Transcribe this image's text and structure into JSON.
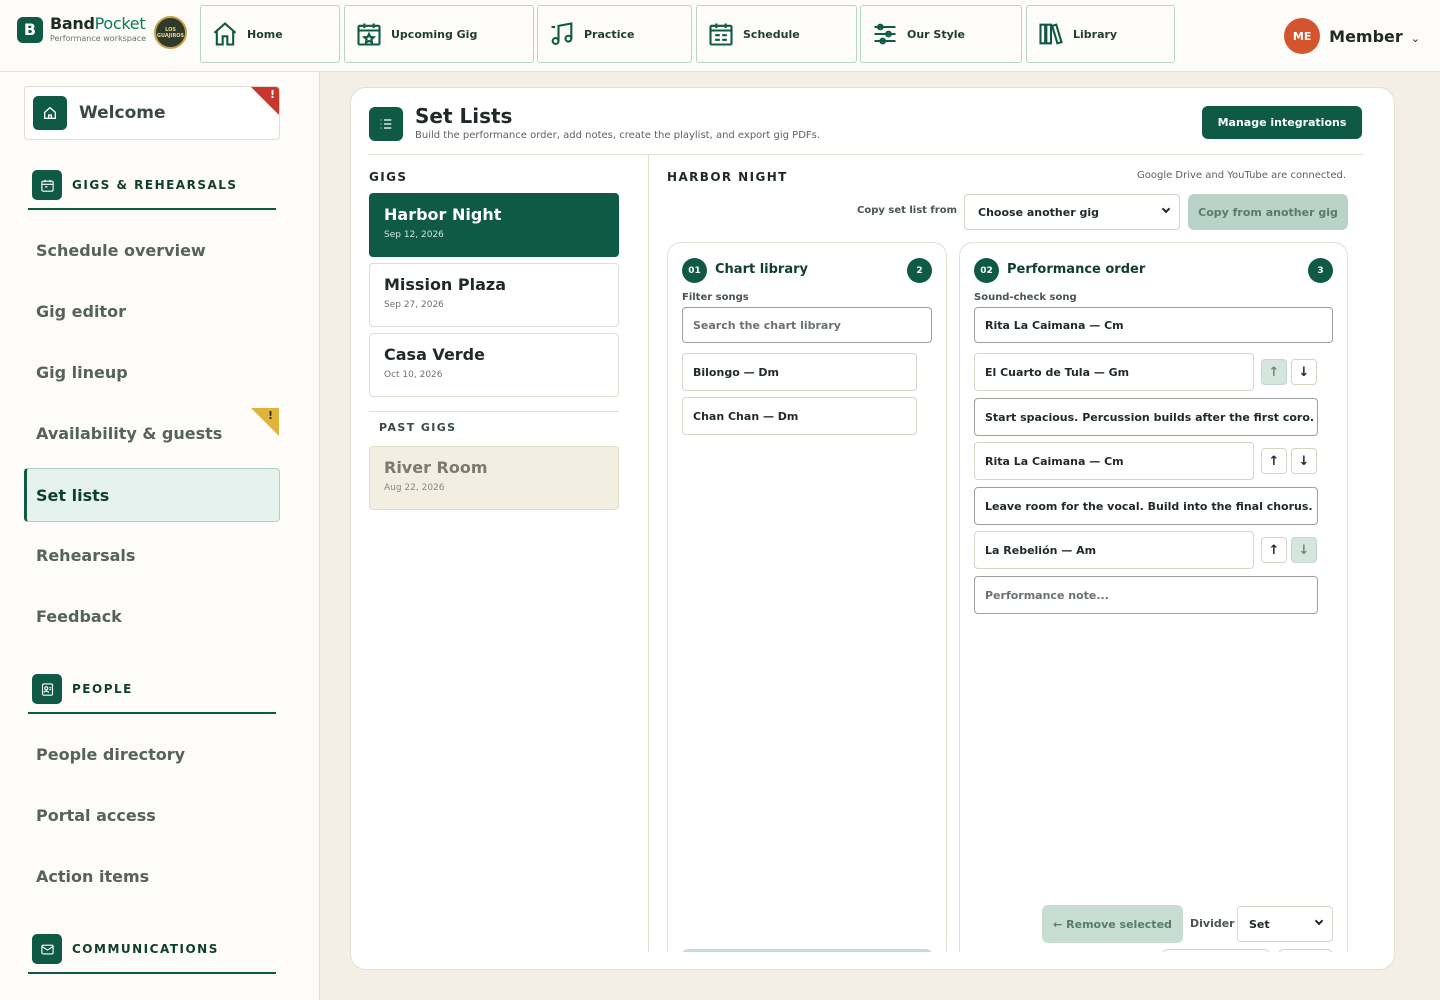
{
  "brand": {
    "mark": "B",
    "name_a": "Band",
    "name_b": "Pocket",
    "subtitle": "Performance workspace",
    "seal_text": "LOS GUAJIROS"
  },
  "nav": [
    {
      "label": "Home",
      "icon": "home-icon"
    },
    {
      "label": "Upcoming Gig",
      "icon": "calendar-star-icon"
    },
    {
      "label": "Practice",
      "icon": "music-note-icon"
    },
    {
      "label": "Schedule",
      "icon": "calendar-grid-icon"
    },
    {
      "label": "Our Style",
      "icon": "sliders-icon"
    },
    {
      "label": "Library",
      "icon": "books-icon"
    }
  ],
  "user": {
    "initials": "ME",
    "name": "Member",
    "avatar_color": "#d4542e"
  },
  "sidebar": {
    "welcome": {
      "label": "Welcome",
      "badge": "!"
    },
    "sections": [
      {
        "label": "GIGS & REHEARSALS",
        "icon": "calendar-icon"
      },
      {
        "label": "PEOPLE",
        "icon": "id-card-icon"
      },
      {
        "label": "COMMUNICATIONS",
        "icon": "mail-icon"
      }
    ],
    "items": [
      "Schedule overview",
      "Gig editor",
      "Gig lineup",
      "Availability & guests",
      "Set lists",
      "Rehearsals",
      "Feedback",
      "People directory",
      "Portal access",
      "Action items"
    ],
    "availability_badge": "!"
  },
  "page": {
    "title": "Set Lists",
    "subtitle": "Build the performance order, add notes, create the playlist, and export gig PDFs.",
    "manage_button": "Manage integrations"
  },
  "gigs": {
    "heading": "GIGS",
    "upcoming": [
      {
        "name": "Harbor Night",
        "date": "Sep 12, 2026"
      },
      {
        "name": "Mission Plaza",
        "date": "Sep 27, 2026"
      },
      {
        "name": "Casa Verde",
        "date": "Oct 10, 2026"
      }
    ],
    "past_heading": "PAST GIGS",
    "past": [
      {
        "name": "River Room",
        "date": "Aug 22, 2026"
      }
    ]
  },
  "editor": {
    "heading": "HARBOR NIGHT",
    "connected_note": "Google Drive and YouTube are connected.",
    "copy_label": "Copy set list from",
    "copy_select": "Choose another gig",
    "copy_button": "Copy from another gig"
  },
  "chart_library": {
    "number": "01",
    "title": "Chart library",
    "count": "2",
    "filter_label": "Filter songs",
    "search_placeholder": "Search the chart library",
    "songs": [
      "Bilongo — Dm",
      "Chan Chan — Dm"
    ]
  },
  "performance": {
    "number": "02",
    "title": "Performance order",
    "count": "3",
    "soundcheck_label": "Sound-check song",
    "soundcheck_value": "Rita La Caimana — Cm",
    "entries": [
      {
        "song": "El Cuarto de Tula — Gm",
        "note": "Start spacious. Percussion builds after the first coro."
      },
      {
        "song": "Rita La Caimana — Cm",
        "note": "Leave room for the vocal. Build into the final chorus."
      },
      {
        "song": "La Rebelión — Am",
        "note": ""
      }
    ],
    "note_placeholder": "Performance note...",
    "remove_button": "← Remove selected",
    "divider_label": "Divider",
    "divider_value": "Set",
    "up_arrow": "↑",
    "down_arrow": "↓"
  }
}
